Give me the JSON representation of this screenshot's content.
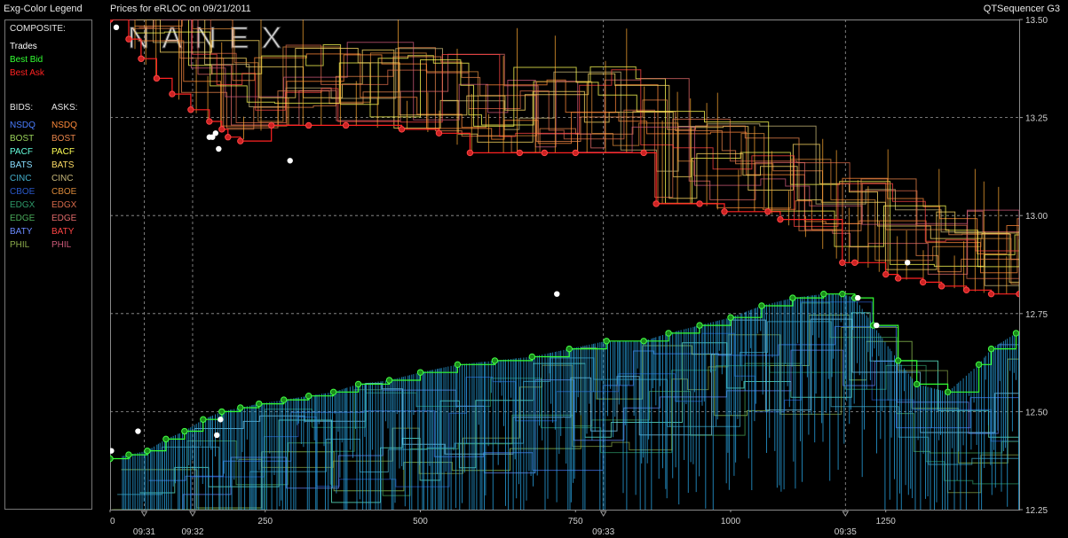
{
  "legend": {
    "title": "Exg-Color Legend",
    "composite_label": "COMPOSITE:",
    "composite": [
      {
        "label": "Trades",
        "color": "#ffffff"
      },
      {
        "label": "Best Bid",
        "color": "#33ff33"
      },
      {
        "label": "Best Ask",
        "color": "#ff2222"
      }
    ],
    "bids_header": "BIDS:",
    "asks_header": "ASKS:",
    "exchanges": [
      {
        "name": "NSDQ",
        "bid_color": "#4a7dff",
        "ask_color": "#ff8a3a"
      },
      {
        "name": "BOST",
        "bid_color": "#9ad25a",
        "ask_color": "#e8844a"
      },
      {
        "name": "PACF",
        "bid_color": "#66ffdd",
        "ask_color": "#ffff55"
      },
      {
        "name": "BATS",
        "bid_color": "#88ddff",
        "ask_color": "#ffdd66"
      },
      {
        "name": "CINC",
        "bid_color": "#44b0cc",
        "ask_color": "#c8b87a"
      },
      {
        "name": "CBOE",
        "bid_color": "#2a58c8",
        "ask_color": "#d8883a"
      },
      {
        "name": "EDGX",
        "bid_color": "#2e9a6a",
        "ask_color": "#d86a4a"
      },
      {
        "name": "EDGE",
        "bid_color": "#4aaa5a",
        "ask_color": "#e06a6a"
      },
      {
        "name": "BATY",
        "bid_color": "#6a8aff",
        "ask_color": "#ff4444"
      },
      {
        "name": "PHIL",
        "bid_color": "#8aaa4a",
        "ask_color": "#cc5a7a"
      }
    ]
  },
  "header": {
    "title": "Prices for  eRLOC  on  09/21/2011",
    "app": "QTSequencer G3"
  },
  "watermark": "NANEX",
  "chart_data": {
    "type": "line",
    "title": "Prices for  eRLOC  on  09/21/2011",
    "xlabel": "",
    "ylabel": "",
    "xlim": [
      0,
      1465
    ],
    "ylim": [
      12.25,
      13.5
    ],
    "x_ticks": [
      0,
      250,
      500,
      750,
      1000,
      1250
    ],
    "x_tick_labels": [
      "0",
      "250",
      "500",
      "750",
      "1000",
      "1250"
    ],
    "y_ticks": [
      12.25,
      12.5,
      12.75,
      13.0,
      13.25,
      13.5
    ],
    "y_tick_labels": [
      "12.25",
      "12.50",
      "12.75",
      "13.00",
      "13.25",
      "13.50"
    ],
    "time_marks": [
      {
        "x": 55,
        "label": "09:31"
      },
      {
        "x": 133,
        "label": "09:32"
      },
      {
        "x": 795,
        "label": "09:33"
      },
      {
        "x": 1185,
        "label": "09:35"
      }
    ],
    "grid": true,
    "series": [
      {
        "name": "Best Ask",
        "color": "#ff2222",
        "x": [
          0,
          30,
          50,
          75,
          100,
          130,
          160,
          180,
          190,
          210,
          260,
          320,
          380,
          470,
          530,
          580,
          660,
          700,
          750,
          860,
          880,
          950,
          990,
          1060,
          1080,
          1180,
          1200,
          1250,
          1270,
          1310,
          1340,
          1380,
          1420,
          1465
        ],
        "y": [
          13.5,
          13.45,
          13.4,
          13.35,
          13.31,
          13.27,
          13.24,
          13.22,
          13.2,
          13.19,
          13.23,
          13.23,
          13.23,
          13.22,
          13.21,
          13.16,
          13.16,
          13.16,
          13.16,
          13.16,
          13.03,
          13.03,
          13.01,
          13.01,
          12.99,
          12.88,
          12.88,
          12.85,
          12.84,
          12.83,
          12.82,
          12.81,
          12.8,
          12.8
        ]
      },
      {
        "name": "Best Bid",
        "color": "#33ff33",
        "x": [
          0,
          30,
          60,
          90,
          120,
          150,
          180,
          210,
          240,
          280,
          320,
          360,
          400,
          450,
          500,
          560,
          620,
          680,
          740,
          800,
          860,
          900,
          950,
          1000,
          1050,
          1100,
          1150,
          1180,
          1200,
          1230,
          1270,
          1300,
          1350,
          1400,
          1420,
          1460
        ],
        "y": [
          12.38,
          12.39,
          12.4,
          12.43,
          12.45,
          12.48,
          12.5,
          12.51,
          12.52,
          12.53,
          12.54,
          12.55,
          12.57,
          12.58,
          12.6,
          12.62,
          12.63,
          12.64,
          12.66,
          12.68,
          12.68,
          12.7,
          12.72,
          12.74,
          12.77,
          12.79,
          12.8,
          12.8,
          12.79,
          12.72,
          12.63,
          12.57,
          12.55,
          12.62,
          12.66,
          12.7
        ]
      },
      {
        "name": "Trades",
        "color": "#ffffff",
        "type": "scatter",
        "x": [
          2,
          10,
          45,
          165,
          170,
          160,
          175,
          178,
          172,
          290,
          720,
          1205,
          1235,
          1285
        ],
        "y": [
          12.4,
          13.48,
          12.45,
          13.2,
          13.21,
          13.2,
          13.17,
          12.48,
          12.44,
          13.14,
          12.8,
          12.79,
          12.72,
          12.88
        ]
      }
    ]
  }
}
